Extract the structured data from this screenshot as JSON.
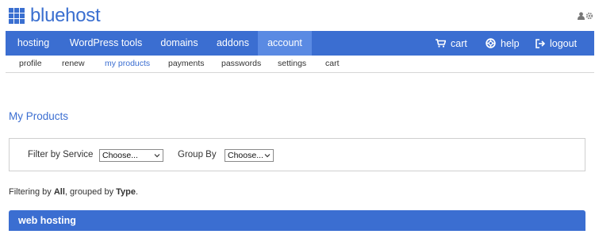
{
  "brand": {
    "name": "bluehost",
    "logo_icon": "grid-logo-icon"
  },
  "user_tools": {
    "icons": [
      "user-icon",
      "gear-icon"
    ]
  },
  "nav": {
    "items": [
      {
        "label": "hosting"
      },
      {
        "label": "WordPress tools"
      },
      {
        "label": "domains"
      },
      {
        "label": "addons"
      },
      {
        "label": "account",
        "active": true
      }
    ],
    "right": [
      {
        "label": "cart",
        "icon": "cart-icon"
      },
      {
        "label": "help",
        "icon": "lifebuoy-icon"
      },
      {
        "label": "logout",
        "icon": "logout-icon"
      }
    ]
  },
  "subnav": {
    "items": [
      {
        "label": "profile"
      },
      {
        "label": "renew"
      },
      {
        "label": "my products",
        "active": true
      },
      {
        "label": "payments"
      },
      {
        "label": "passwords"
      },
      {
        "label": "settings"
      },
      {
        "label": "cart"
      }
    ]
  },
  "page": {
    "title": "My Products"
  },
  "filters": {
    "service_label": "Filter by Service",
    "service_value": "Choose...",
    "group_label": "Group By",
    "group_value": "Choose..."
  },
  "status": {
    "prefix": "Filtering by ",
    "filter": "All",
    "middle": ", grouped by ",
    "group": "Type",
    "suffix": "."
  },
  "section": {
    "title": "web hosting"
  },
  "colors": {
    "brand_blue": "#3b6ed1",
    "active_tab": "#5a8ae3",
    "logo_blue": "#3a6fd0"
  }
}
